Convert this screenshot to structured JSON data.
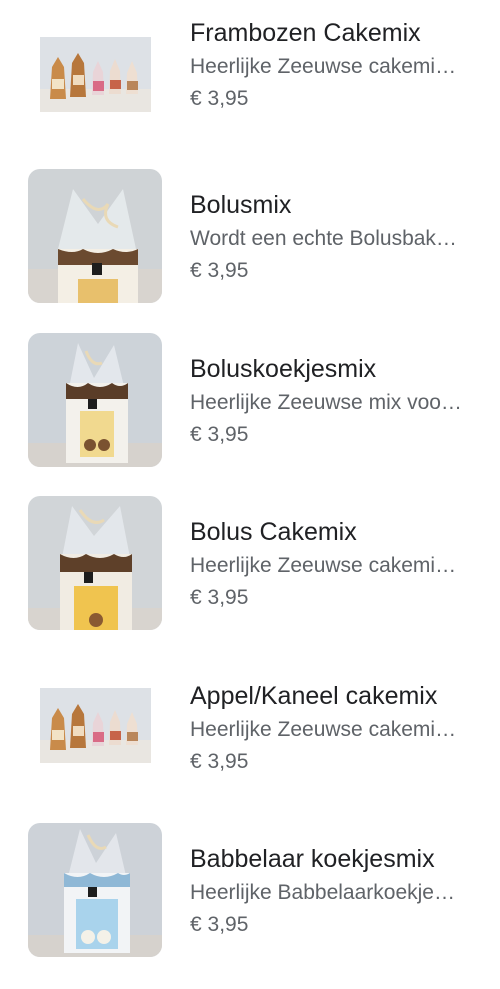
{
  "products": [
    {
      "title": "Frambozen Cakemix",
      "description": "Heerlijke Zeeuwse cakemi…",
      "price": "€ 3,95",
      "image": "multi-bag-product-photo"
    },
    {
      "title": "Bolusmix",
      "description": "Wordt een echte Bolusbak…",
      "price": "€ 3,95",
      "image": "bolusmix-bag-photo"
    },
    {
      "title": "Boluskoekjesmix",
      "description": "Heerlijke Zeeuwse mix voo…",
      "price": "€ 3,95",
      "image": "boluskoekjes-bag-photo"
    },
    {
      "title": "Bolus Cakemix",
      "description": "Heerlijke Zeeuwse cakemi…",
      "price": "€ 3,95",
      "image": "bolus-cakemix-bag-photo"
    },
    {
      "title": "Appel/Kaneel cakemix",
      "description": "Heerlijke Zeeuwse cakemi…",
      "price": "€ 3,95",
      "image": "multi-bag-product-photo"
    },
    {
      "title": "Babbelaar koekjesmix",
      "description": "Heerlijke Babbelaarkoekje…",
      "price": "€ 3,95",
      "image": "babbelaar-bag-photo"
    }
  ],
  "colors": {
    "title_text": "#202124",
    "secondary_text": "#5f6368",
    "background": "#ffffff"
  }
}
